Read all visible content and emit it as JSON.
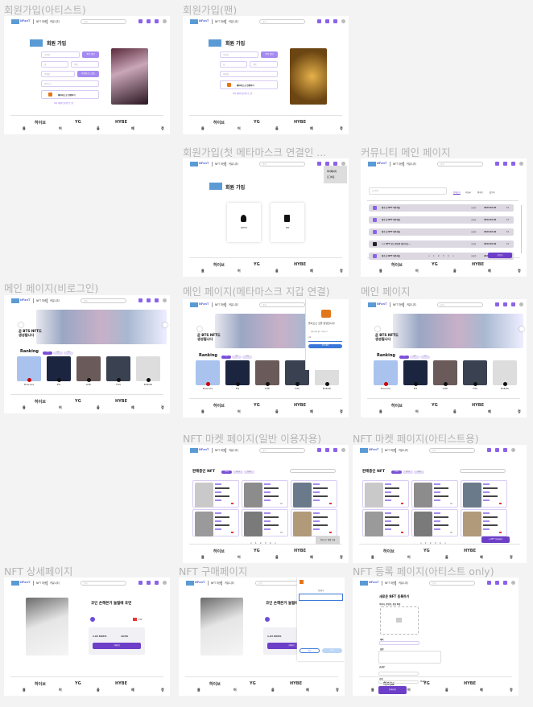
{
  "header": {
    "logo": "NFanT",
    "nav": [
      "NFT 마켓",
      "커뮤니티"
    ],
    "search_placeholder": "검색"
  },
  "footer": {
    "characters": [
      "들",
      "어",
      "올",
      "예",
      "정"
    ],
    "logos": [
      "하이브",
      "YG",
      "HYBE"
    ]
  },
  "colors": {
    "accent": "#6d3fc8",
    "light_accent": "#a58bf0",
    "logo": "#5b9bd5",
    "canvas": "#f3f3f3"
  },
  "frames": [
    {
      "id": "signup-artist",
      "label": "회원가입(아티스트)",
      "title": "회원 가입",
      "fields": [
        "닉네임",
        "성",
        "이름",
        "이메일",
        "인증코드"
      ],
      "buttons": [
        "중복 확인",
        "이메일코드 발송"
      ],
      "metamask": "메타마스크 연결하기",
      "link": "이미 계정이 있다면 로그인"
    },
    {
      "id": "signup-fan",
      "label": "회원가입(팬)",
      "title": "회원 가입",
      "fields": [
        "닉네임",
        "성",
        "이름",
        "이메일"
      ],
      "buttons": [
        "중복 확인"
      ],
      "metamask": "메타마스크 연결하기",
      "link": "이미 계정이 있다면 로그인"
    },
    {
      "id": "signup-first",
      "label": "회원가입(첫 메타마스크 연결인 ...",
      "title": "회원 가입",
      "options": [
        "ARTIST",
        "FAN"
      ],
      "menu": [
        "마이페이지",
        "로그아웃"
      ]
    },
    {
      "id": "community",
      "label": "커뮤니티 메인 페이지",
      "search": "글 검색",
      "tabs": [
        "전체보기",
        "자유글",
        "팬사인",
        "같이가"
      ],
      "posts": [
        {
          "title": "제가 산 NFT 봐주세요",
          "author": "조회수",
          "date": "2023-03-02",
          "count": "12"
        },
        {
          "title": "제가 산 NFT 봐주세요",
          "author": "조회수",
          "date": "2023-03-02",
          "count": "12"
        },
        {
          "title": "제가 산 NFT 봐주세요",
          "author": "조회수",
          "date": "2023-03-02",
          "count": "12"
        },
        {
          "title": "ㅇㅇ NFT 갖고 계신분 계신가요...",
          "author": "조회수",
          "date": "2023-03-02",
          "count": "12"
        },
        {
          "title": "제가 산 NFT 봐주세요",
          "author": "조회수",
          "date": "2023-03-02",
          "count": "12"
        }
      ],
      "pages": [
        "<",
        "1",
        "2",
        "3",
        "4",
        ">"
      ],
      "write": "글쓰기"
    },
    {
      "id": "main-guest",
      "label": "메인 페이지(비로그인)",
      "banner": "곧 BTS NFT도 생성됩니다",
      "ranking": "Ranking",
      "chips": [
        "주간",
        "월간",
        "전체"
      ],
      "artists": [
        "Brave Girls",
        "BTS",
        "AKMU",
        "TVXQ",
        "BIGBANG"
      ]
    },
    {
      "id": "main-wallet",
      "label": "메인 페이지(메타마스크 지갑 연결)",
      "banner": "곧 BTS NFT도 생성됩니다",
      "ranking": "Ranking",
      "chips": [
        "주간",
        "월간",
        "전체"
      ],
      "artists": [
        "Brave Girls",
        "BTS",
        "AKMU",
        "TVXQ",
        "BIGBANG"
      ],
      "wallet": {
        "welcome": "돌아오신 것을 환영합니다!",
        "sub": "탈중앙화된 웹이 기다립니다",
        "pw": "암호",
        "unlock": "잠금 해제"
      }
    },
    {
      "id": "main",
      "label": "메인 페이지",
      "banner": "곧 BTS NFT도 생성됩니다",
      "ranking": "Ranking",
      "chips": [
        "주간",
        "월간",
        "전체"
      ],
      "artists": [
        "Brave Girls",
        "BTS",
        "AKMU",
        "TVXQ",
        "BIGBANG"
      ]
    },
    {
      "id": "market-user",
      "label": "NFT 마켓 페이지(일반 이용자용)",
      "title": "판매중인 NFT",
      "chips": [
        "최신순",
        "인기순",
        "가격순"
      ],
      "pages": [
        "<",
        "1",
        "2",
        "3",
        "4",
        ">"
      ],
      "action": "아티스트 계정 등록"
    },
    {
      "id": "market-artist",
      "label": "NFT 마켓 페이지(아티스트용)",
      "title": "판매중인 NFT",
      "chips": [
        "최신순",
        "인기순",
        "가격순"
      ],
      "pages": [
        "<",
        "1",
        "2",
        "3",
        "4",
        ">"
      ],
      "action": "+ NFT 등록하기"
    },
    {
      "id": "detail",
      "label": "NFT 상세페이지",
      "title": "코인 손해본거 눌릴때 호연",
      "price": "1.03 MATIC",
      "stock": "16/50",
      "likes": "152",
      "buy": "구매하기"
    },
    {
      "id": "buy",
      "label": "NFT 구매페이지",
      "title": "코인 손해본거 눌릴때 호연",
      "price": "1.03 MATIC",
      "buy": "구매하기",
      "mm": {
        "send": "보내기",
        "cancel": "취소",
        "confirm": "다음"
      }
    },
    {
      "id": "register",
      "label": "NFT 등록 페이지(아티스트 only)",
      "title": "새로운 NFT 등록하기",
      "fields": [
        "이미지, 동영상, 음성 파일",
        "제목",
        "설명",
        "공급량",
        "가격"
      ],
      "unit": "MATIC",
      "submit": "등록하기"
    }
  ]
}
